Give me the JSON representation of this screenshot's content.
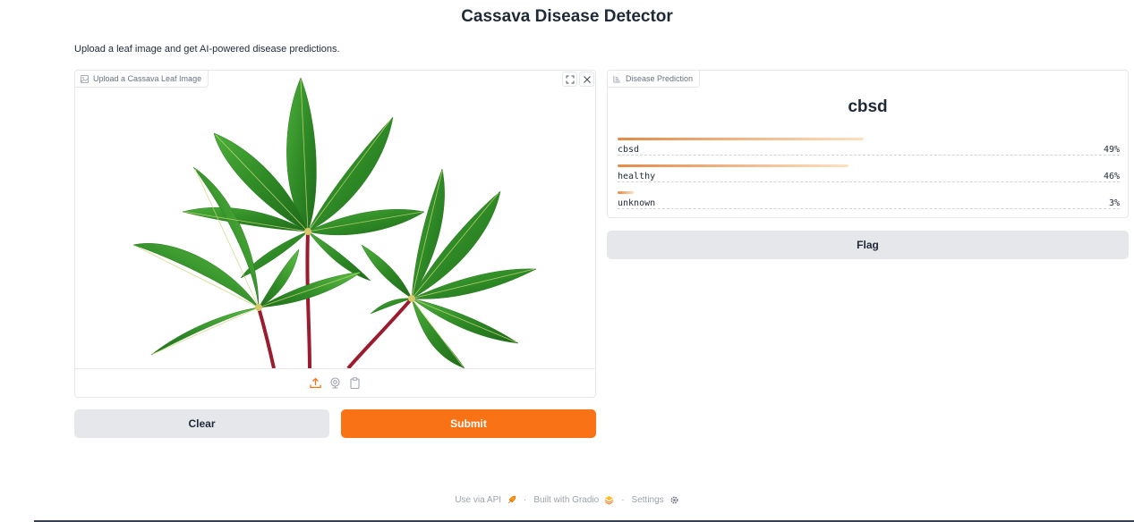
{
  "page": {
    "title": "Cassava Disease Detector",
    "description": "Upload a leaf image and get AI-powered disease predictions."
  },
  "image_input": {
    "label": "Upload a Cassava Leaf Image",
    "image_icon": "image-icon",
    "toolbar": {
      "fullscreen_icon": "fullscreen-icon",
      "clear_icon": "close-icon"
    },
    "sources": [
      "upload-icon",
      "webcam-icon",
      "clipboard-icon"
    ],
    "accent": "#f97316"
  },
  "prediction": {
    "label": "Disease Prediction",
    "label_icon": "label-icon",
    "top_label": "cbsd",
    "confidences": [
      {
        "label": "cbsd",
        "value": "49%",
        "fraction": 0.49
      },
      {
        "label": "healthy",
        "value": "46%",
        "fraction": 0.46
      },
      {
        "label": "unknown",
        "value": "3%",
        "fraction": 0.03
      }
    ]
  },
  "buttons": {
    "clear": "Clear",
    "submit": "Submit",
    "flag": "Flag"
  },
  "footer": {
    "api": "Use via API",
    "built": "Built with Gradio",
    "settings": "Settings"
  },
  "colors": {
    "primary": "#f97316",
    "secondary": "#e5e7eb",
    "bar_start": "#e58a46",
    "bar_end": "#fde0c2"
  }
}
